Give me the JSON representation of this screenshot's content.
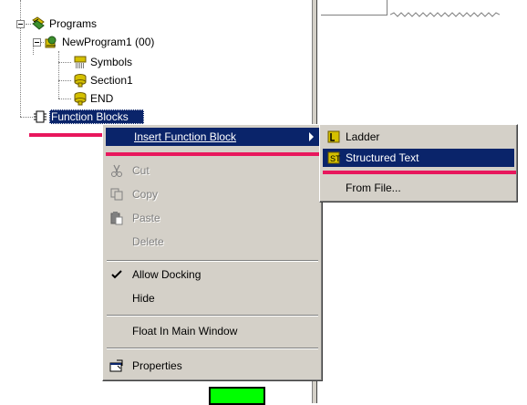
{
  "tree": {
    "programs": "Programs",
    "new_program": "NewProgram1 (00)",
    "symbols": "Symbols",
    "section": "Section1",
    "end": "END",
    "function_blocks": "Function Blocks"
  },
  "context_menu": {
    "insert_function_block": "Insert Function Block",
    "cut": "Cut",
    "copy": "Copy",
    "paste": "Paste",
    "delete": "Delete",
    "allow_docking": "Allow Docking",
    "hide": "Hide",
    "float_in_main_window": "Float In Main Window",
    "properties": "Properties"
  },
  "submenu": {
    "ladder": "Ladder",
    "structured_text": "Structured Text",
    "from_file": "From File..."
  },
  "colors": {
    "highlight": "#0a246a",
    "annotation": "#e8175d",
    "marker": "#00ff00",
    "menu_bg": "#d4d0c8"
  },
  "icons": {
    "programs": "programs-folder-icon",
    "new_program": "program-icon",
    "symbols": "symbols-icon",
    "section": "section-icon",
    "end": "end-icon",
    "function_blocks": "function-block-icon",
    "cut": "cut-icon",
    "copy": "copy-icon",
    "paste": "paste-icon",
    "allow_docking": "checkmark-icon",
    "properties": "properties-icon",
    "ladder": "ladder-icon",
    "structured_text": "structured-text-icon"
  }
}
